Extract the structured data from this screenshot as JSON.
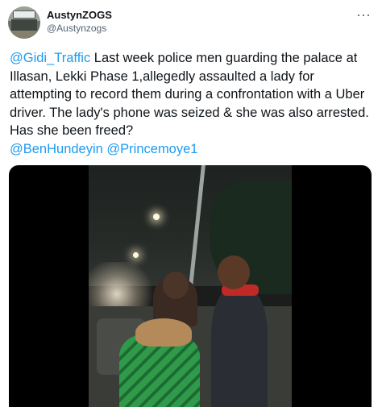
{
  "user": {
    "display_name": "AustynZOGS",
    "handle": "@Austynzogs"
  },
  "more_label": "···",
  "tweet": {
    "segments": [
      {
        "text": "@Gidi_Traffic",
        "mention": true
      },
      {
        "text": " Last week police men guarding the palace at Illasan, Lekki Phase 1,allegedly assaulted a lady for attempting to record them during a confrontation with a Uber driver. The lady's phone was seized & she was also arrested. Has she been freed?\n",
        "mention": false
      },
      {
        "text": "@BenHundeyin",
        "mention": true
      },
      {
        "text": " ",
        "mention": false
      },
      {
        "text": "@Princemoye1",
        "mention": true
      }
    ]
  },
  "colors": {
    "mention": "#1d9bf0",
    "text": "#0f1419",
    "secondary": "#536471"
  },
  "icons": {
    "more": "more-horizontal-icon"
  }
}
